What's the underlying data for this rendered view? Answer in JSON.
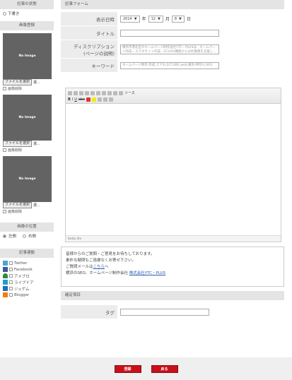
{
  "left": {
    "status_header": "記事の状態",
    "status_option": "下書き",
    "image_header": "画像登録",
    "no_image": "No Image",
    "file_button": "ファイルを選択",
    "file_suffix": "選...",
    "delete_label": "画像削除",
    "position_header": "画像の位置",
    "pos_left": "左側",
    "pos_right": "右側",
    "sns_header": "記事連動",
    "sns": [
      "Twitter",
      "Facebook",
      "アメブロ",
      "ライブドア",
      "ジュゲム",
      "Blogger"
    ]
  },
  "main": {
    "header": "記事フォーム",
    "date_label": "表示日時",
    "year": "2014",
    "year_suffix": "年",
    "month": "12",
    "month_suffix": "月",
    "day": "8",
    "day_suffix": "日",
    "title_label": "タイトル",
    "title_value": "",
    "desc_label": "ディスクリプション",
    "desc_sublabel": "(ページの説明)",
    "desc_value": "横浜市港北区のホームページ制作会社YTC・PLUSは、ホームページ作成・スマホサイト作成、EC(HR)構築から分析業務を支援し...",
    "keyword_label": "キーワード",
    "keyword_value": "ホームページ制作,作成,スマホ,ECCUBE,web,横浜,神奈川,SEO",
    "source_label": "ソース",
    "editor_footer": "body  div",
    "note_line1": "皆様からのご質問・ご意見をお待ちしております。",
    "note_line2": "素朴な疑問もご遠慮なくお寄せ下さい。",
    "note_line3_prefix": "ご質問メールは",
    "note_line3_link": "こちら",
    "note_line3_suffix": "へ",
    "note_line4_prefix": "横浜のSEO、ホームページ制作会社 ",
    "note_line4_link": "株式会社YTC・PLUS",
    "confirm_header": "確定項目",
    "tag_label": "タグ",
    "tag_value": ""
  },
  "actions": {
    "register": "登録",
    "back": "戻る"
  },
  "colors": {
    "button_red": "#c9101a",
    "twitter": "#4aa3df",
    "facebook": "#3b5998",
    "ameblo": "#2e8b3a",
    "livedoor": "#1b9dd9",
    "jugem": "#1e6fb5",
    "blogger": "#f57d00"
  }
}
